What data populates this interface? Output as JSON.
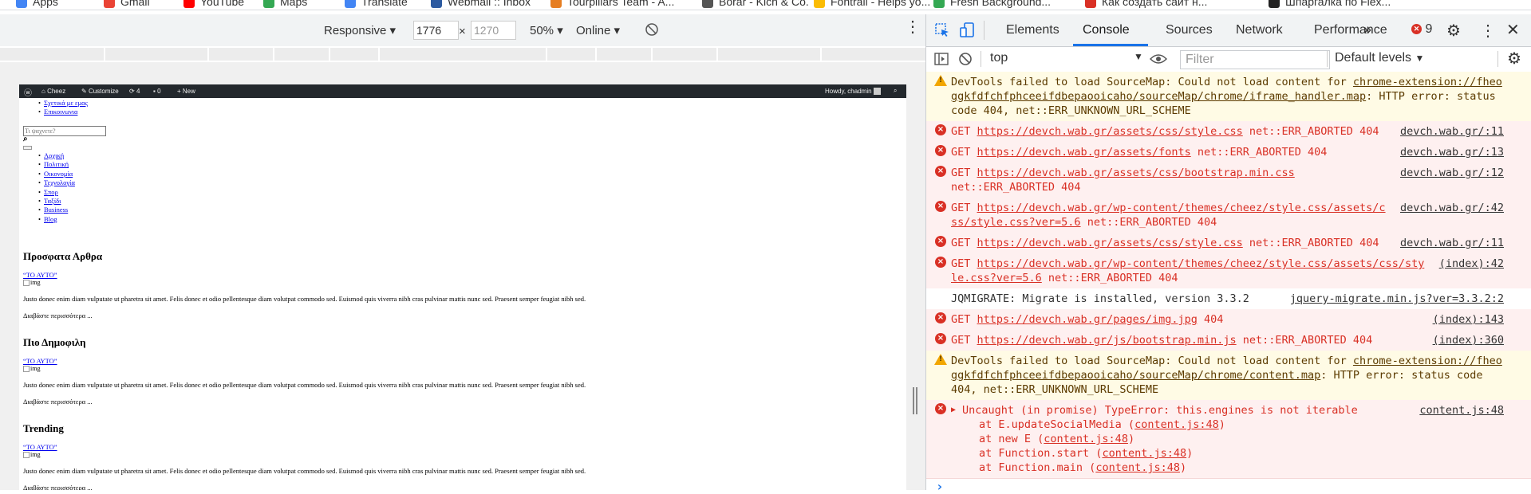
{
  "bookmarks": [
    {
      "label": "Apps",
      "color": "#4285f4"
    },
    {
      "label": "Gmail",
      "color": "#ea4335"
    },
    {
      "label": "YouTube",
      "color": "#ff0000"
    },
    {
      "label": "Maps",
      "color": "#34a853"
    },
    {
      "label": "Translate",
      "color": "#4285f4"
    },
    {
      "label": "Webmail :: Inbox",
      "color": "#2c5aa0"
    },
    {
      "label": "Tourpillars Team - A...",
      "color": "#e67e22"
    },
    {
      "label": "Borar - Kich & Co.",
      "color": "#555555"
    },
    {
      "label": "Fontrail - Helps yo...",
      "color": "#fbbc04"
    },
    {
      "label": "Fresh Background...",
      "color": "#34a853"
    },
    {
      "label": "Как создать сайт н...",
      "color": "#d93025"
    },
    {
      "label": "Шпаргалка по Flex...",
      "color": "#222222"
    }
  ],
  "device_toolbar": {
    "device": "Responsive",
    "width": "1776",
    "height": "1270",
    "times": "×",
    "zoom": "50%",
    "network": "Online"
  },
  "page": {
    "adminbar": {
      "site": "Cheez",
      "customize": "Customize",
      "updates": "4",
      "comments": "0",
      "new": "New",
      "howdy": "Howdy, chadmin"
    },
    "top_links": [
      "Σχετικά με εμας",
      "Επικοινωνια"
    ],
    "search_placeholder": "Τι ψαχνετε?",
    "nav": [
      "Αρχική",
      "Πολιτική",
      "Οικονομία",
      "Τεχνολογία",
      "Σπορ",
      "Ταξίδι",
      "Business",
      "Blog"
    ],
    "sections": [
      {
        "heading": "Προσφατα Αρθρα",
        "link": "“ΤΟ ΑΥΤΟ”",
        "img": "img",
        "text": "Justo donec enim diam vulputate ut pharetra sit amet. Felis donec et odio pellentesque diam volutpat commodo sed. Euismod quis viverra nibh cras pulvinar mattis nunc sed. Praesent semper feugiat nibh sed.",
        "more": "Διαβάστε περισσότερα ..."
      },
      {
        "heading": "Πιο Δημοφιλη",
        "link": "“ΤΟ ΑΥΤΟ”",
        "img": "img",
        "text": "Justo donec enim diam vulputate ut pharetra sit amet. Felis donec et odio pellentesque diam volutpat commodo sed. Euismod quis viverra nibh cras pulvinar mattis nunc sed. Praesent semper feugiat nibh sed.",
        "more": "Διαβάστε περισσότερα ..."
      },
      {
        "heading": "Trending",
        "link": "“ΤΟ ΑΥΤΟ”",
        "img": "img",
        "text": "Justo donec enim diam vulputate ut pharetra sit amet. Felis donec et odio pellentesque diam volutpat commodo sed. Euismod quis viverra nibh cras pulvinar mattis nunc sed. Praesent semper feugiat nibh sed.",
        "more": "Διαβάστε περισσότερα ..."
      }
    ]
  },
  "devtools": {
    "tabs": [
      "Elements",
      "Console",
      "Sources",
      "Network",
      "Performance"
    ],
    "active_tab": "Console",
    "more": "»",
    "error_count": "9",
    "context": "top",
    "filter_placeholder": "Filter",
    "levels": "Default levels",
    "messages": [
      {
        "type": "warn",
        "lines": [
          {
            "parts": [
              {
                "t": "DevTools failed to load SourceMap: Could not load content for "
              },
              {
                "t": "chrome-extension://fheo",
                "u": true
              }
            ]
          },
          {
            "parts": [
              {
                "t": "ggkfdfchfphceeifdbepaooicaho/sourceMap/chrome/iframe_handler.map",
                "u": true
              },
              {
                "t": ": HTTP error: status"
              }
            ]
          },
          {
            "parts": [
              {
                "t": "code 404, net::ERR_UNKNOWN_URL_SCHEME"
              }
            ]
          }
        ]
      },
      {
        "type": "err",
        "source": "devch.wab.gr/:11",
        "lines": [
          {
            "parts": [
              {
                "t": "GET "
              },
              {
                "t": "https://devch.wab.gr/assets/css/style.css",
                "u": true
              },
              {
                "t": " net::ERR_ABORTED 404"
              }
            ]
          }
        ]
      },
      {
        "type": "err",
        "source": "devch.wab.gr/:13",
        "lines": [
          {
            "parts": [
              {
                "t": "GET "
              },
              {
                "t": "https://devch.wab.gr/assets/fonts",
                "u": true
              },
              {
                "t": " net::ERR_ABORTED 404"
              }
            ]
          }
        ]
      },
      {
        "type": "err",
        "source": "devch.wab.gr/:12",
        "lines": [
          {
            "parts": [
              {
                "t": "GET "
              },
              {
                "t": "https://devch.wab.gr/assets/css/bootstrap.min.css",
                "u": true
              }
            ]
          },
          {
            "parts": [
              {
                "t": "net::ERR_ABORTED 404"
              }
            ]
          }
        ]
      },
      {
        "type": "err",
        "source": "devch.wab.gr/:42",
        "lines": [
          {
            "parts": [
              {
                "t": "GET "
              },
              {
                "t": "https://devch.wab.gr/wp-content/themes/cheez/style.css/assets/c",
                "u": true
              }
            ]
          },
          {
            "parts": [
              {
                "t": "ss/style.css?ver=5.6",
                "u": true
              },
              {
                "t": " net::ERR_ABORTED 404"
              }
            ]
          }
        ]
      },
      {
        "type": "err",
        "source": "devch.wab.gr/:11",
        "lines": [
          {
            "parts": [
              {
                "t": "GET "
              },
              {
                "t": "https://devch.wab.gr/assets/css/style.css",
                "u": true
              },
              {
                "t": " net::ERR_ABORTED 404"
              }
            ]
          }
        ]
      },
      {
        "type": "err",
        "source": "(index):42",
        "lines": [
          {
            "parts": [
              {
                "t": "GET "
              },
              {
                "t": "https://devch.wab.gr/wp-content/themes/cheez/style.css/assets/css/sty",
                "u": true
              }
            ]
          },
          {
            "parts": [
              {
                "t": "le.css?ver=5.6",
                "u": true
              },
              {
                "t": " net::ERR_ABORTED 404"
              }
            ]
          }
        ]
      },
      {
        "type": "info",
        "source": "jquery-migrate.min.js?ver=3.3.2:2",
        "lines": [
          {
            "parts": [
              {
                "t": "JQMIGRATE: Migrate is installed, version 3.3.2"
              }
            ]
          }
        ]
      },
      {
        "type": "err",
        "source": "(index):143",
        "lines": [
          {
            "parts": [
              {
                "t": "GET "
              },
              {
                "t": "https://devch.wab.gr/pages/img.jpg",
                "u": true
              },
              {
                "t": " 404"
              }
            ]
          }
        ]
      },
      {
        "type": "err",
        "source": "(index):360",
        "lines": [
          {
            "parts": [
              {
                "t": "GET "
              },
              {
                "t": "https://devch.wab.gr/js/bootstrap.min.js",
                "u": true
              },
              {
                "t": " net::ERR_ABORTED 404"
              }
            ]
          }
        ]
      },
      {
        "type": "warn",
        "lines": [
          {
            "parts": [
              {
                "t": "DevTools failed to load SourceMap: Could not load content for "
              },
              {
                "t": "chrome-extension://fheo",
                "u": true
              }
            ]
          },
          {
            "parts": [
              {
                "t": "ggkfdfchfphceeifdbepaooicaho/sourceMap/chrome/content.map",
                "u": true
              },
              {
                "t": ": HTTP error: status code"
              }
            ]
          },
          {
            "parts": [
              {
                "t": "404, net::ERR_UNKNOWN_URL_SCHEME"
              }
            ]
          }
        ]
      },
      {
        "type": "err",
        "source": "content.js:48",
        "expand": "▶",
        "lines": [
          {
            "parts": [
              {
                "t": "Uncaught (in promise) TypeError: this.engines is not iterable"
              }
            ]
          },
          {
            "indent": true,
            "parts": [
              {
                "t": "at E.updateSocialMedia ("
              },
              {
                "t": "content.js:48",
                "u": true
              },
              {
                "t": ")"
              }
            ]
          },
          {
            "indent": true,
            "parts": [
              {
                "t": "at new E ("
              },
              {
                "t": "content.js:48",
                "u": true
              },
              {
                "t": ")"
              }
            ]
          },
          {
            "indent": true,
            "parts": [
              {
                "t": "at Function.start ("
              },
              {
                "t": "content.js:48",
                "u": true
              },
              {
                "t": ")"
              }
            ]
          },
          {
            "indent": true,
            "parts": [
              {
                "t": "at Function.main ("
              },
              {
                "t": "content.js:48",
                "u": true
              },
              {
                "t": ")"
              }
            ]
          }
        ]
      }
    ],
    "prompt": "›"
  },
  "colors": {
    "accent": "#1a73e8",
    "error": "#d93025",
    "error_bg": "#fef0f0",
    "warn_bg": "#fffbe5",
    "warn_icon": "#f2a600",
    "adminbar": "#23282d"
  }
}
